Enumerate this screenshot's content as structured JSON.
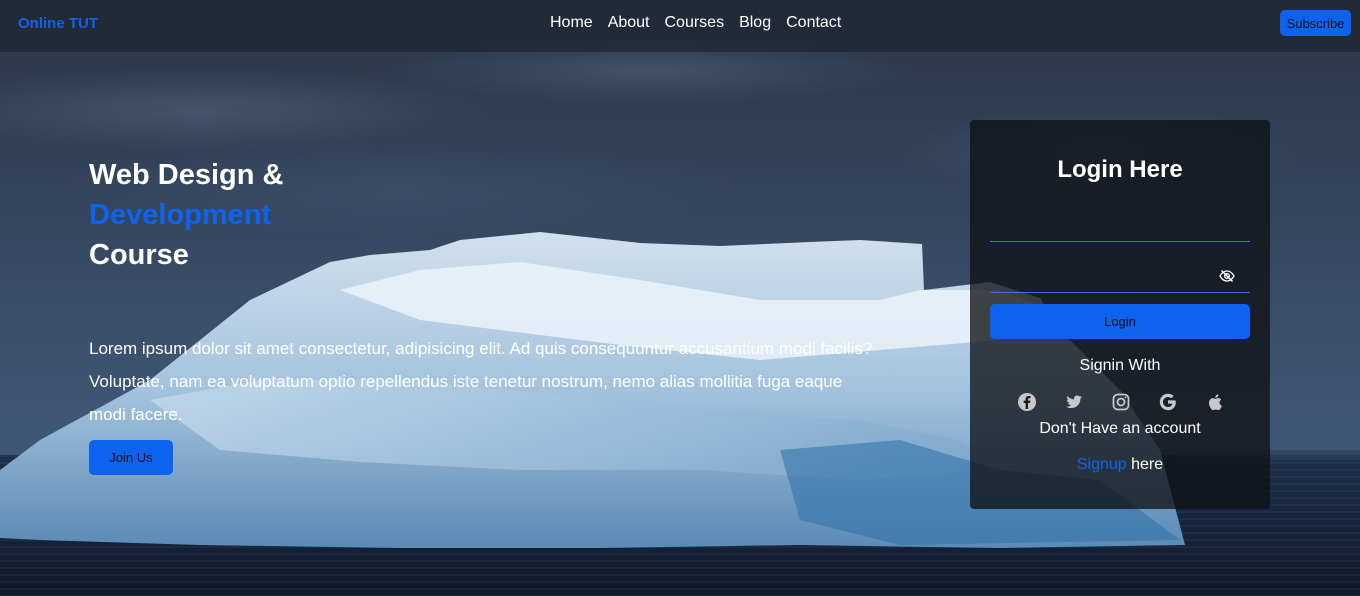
{
  "brand": "Online TUT",
  "nav": {
    "items": [
      "Home",
      "About",
      "Courses",
      "Blog",
      "Contact"
    ],
    "subscribe_label": "Subscribe"
  },
  "hero": {
    "title_line1": "Web Design &",
    "title_line2": "Development",
    "title_line3": "Course",
    "paragraph": "Lorem ipsum dolor sit amet consectetur, adipisicing elit. Ad quis consequuntur accusantium modi facilis? Voluptate, nam ea voluptatum optio repellendus iste tenetur nostrum, nemo alias mollitia fuga eaque modi facere.",
    "join_label": "Join Us"
  },
  "login": {
    "title": "Login Here",
    "username_value": "",
    "password_value": "",
    "button_label": "Login",
    "signin_with": "Signin With",
    "social_icons": [
      "facebook-icon",
      "twitter-icon",
      "instagram-icon",
      "google-icon",
      "apple-icon"
    ],
    "no_account": "Don't Have an account",
    "signup_link": "Signup",
    "signup_suffix": " here"
  },
  "colors": {
    "accent": "#0d63f0",
    "card_bg": "#0f1216",
    "nav_bg": "#1e2632"
  }
}
